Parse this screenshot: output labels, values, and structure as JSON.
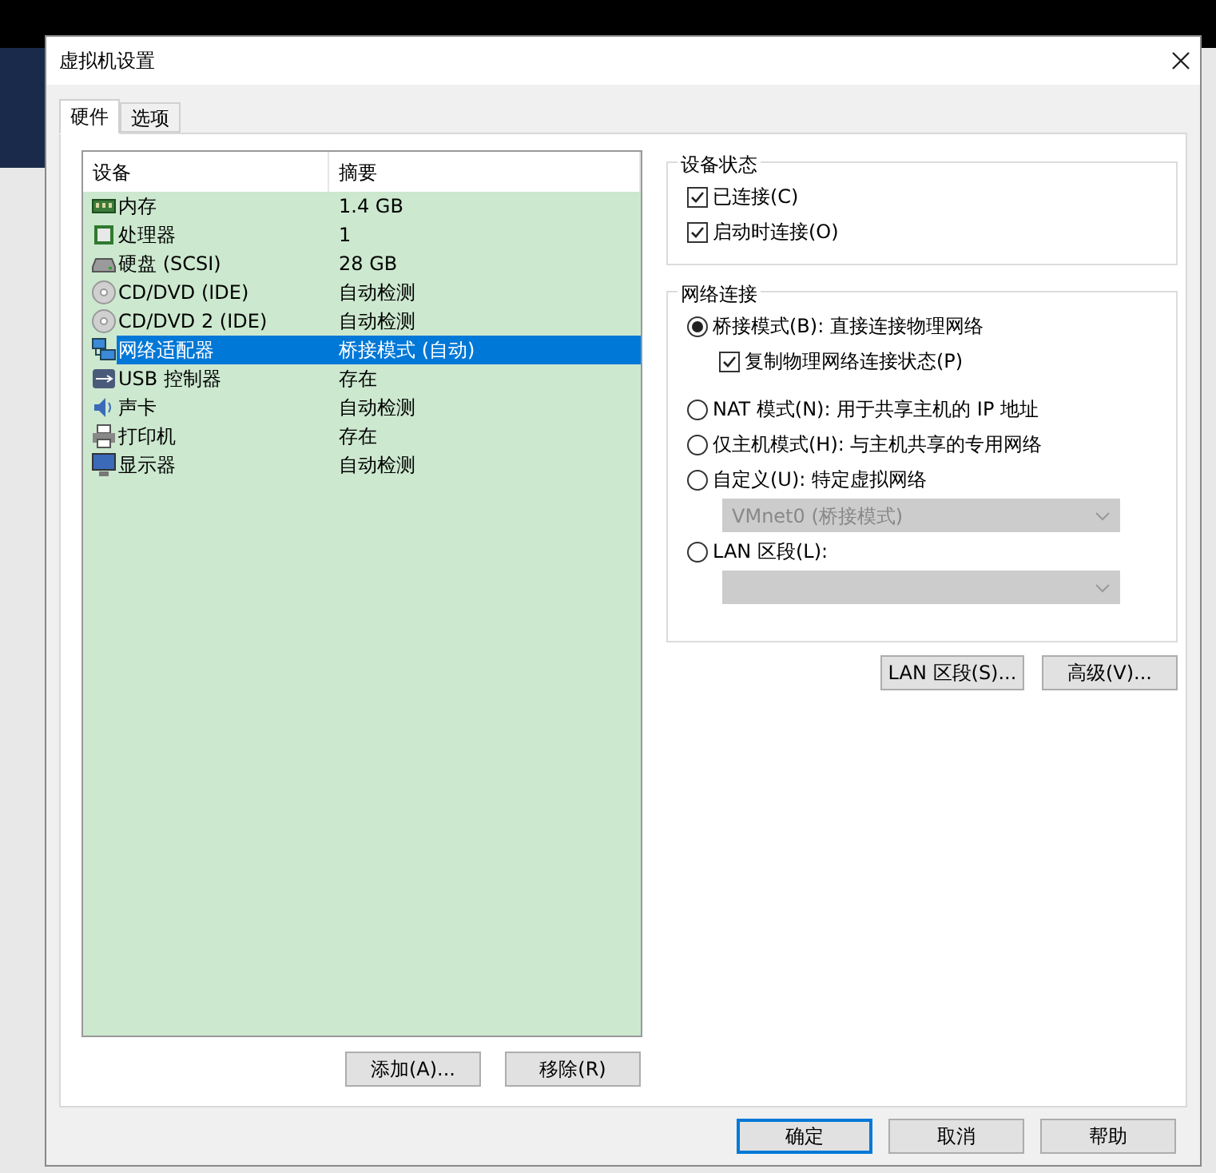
{
  "window": {
    "title": "虚拟机设置"
  },
  "tabs": [
    {
      "label": "硬件",
      "selected": true
    },
    {
      "label": "选项",
      "selected": false
    }
  ],
  "device_table": {
    "columns": [
      "设备",
      "摘要"
    ],
    "rows": [
      {
        "device": "内存",
        "summary": "1.4 GB",
        "selected": false
      },
      {
        "device": "处理器",
        "summary": "1",
        "selected": false
      },
      {
        "device": "硬盘 (SCSI)",
        "summary": "28 GB",
        "selected": false
      },
      {
        "device": "CD/DVD (IDE)",
        "summary": "自动检测",
        "selected": false
      },
      {
        "device": "CD/DVD 2 (IDE)",
        "summary": "自动检测",
        "selected": false
      },
      {
        "device": "网络适配器",
        "summary": "桥接模式 (自动)",
        "selected": true
      },
      {
        "device": "USB 控制器",
        "summary": "存在",
        "selected": false
      },
      {
        "device": "声卡",
        "summary": "自动检测",
        "selected": false
      },
      {
        "device": "打印机",
        "summary": "存在",
        "selected": false
      },
      {
        "device": "显示器",
        "summary": "自动检测",
        "selected": false
      }
    ]
  },
  "list_buttons": [
    "添加(A)...",
    "移除(R)"
  ],
  "device_status": {
    "title": "设备状态",
    "items": [
      {
        "label": "已连接(C)",
        "checked": true
      },
      {
        "label": "启动时连接(O)",
        "checked": true
      }
    ]
  },
  "network_connection": {
    "title": "网络连接",
    "options": [
      {
        "label": "桥接模式(B): 直接连接物理网络",
        "selected": true,
        "checkbox": {
          "label": "复制物理网络连接状态(P)",
          "checked": true
        }
      },
      {
        "label": "NAT 模式(N): 用于共享主机的 IP 地址",
        "selected": false
      },
      {
        "label": "仅主机模式(H): 与主机共享的专用网络",
        "selected": false
      },
      {
        "label": "自定义(U): 特定虚拟网络",
        "selected": false,
        "dropdown": {
          "value": "VMnet0 (桥接模式)",
          "disabled": true
        }
      },
      {
        "label": "LAN 区段(L):",
        "selected": false,
        "dropdown": {
          "disabled": true
        }
      }
    ]
  },
  "network_buttons": [
    "LAN 区段(S)...",
    "高级(V)..."
  ],
  "footer_buttons": [
    {
      "label": "确定",
      "default": true
    },
    {
      "label": "取消",
      "default": false
    },
    {
      "label": "帮助",
      "default": false
    }
  ]
}
